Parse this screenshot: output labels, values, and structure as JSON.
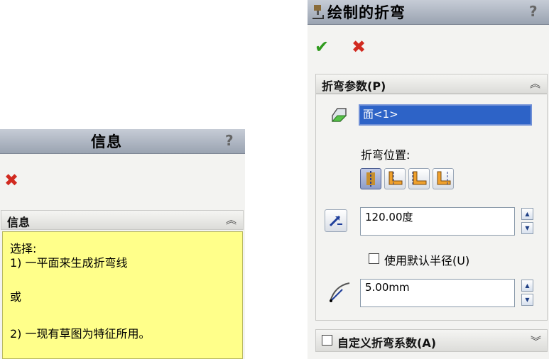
{
  "info_panel": {
    "title": "信息",
    "help": "?",
    "group_title": "信息",
    "lines": {
      "line1": "选择:",
      "line2": "1) 一平面来生成折弯线",
      "line3": "或",
      "line4": "2) 一现有草图为特征所用。"
    }
  },
  "bend_panel": {
    "title": "绘制的折弯",
    "help": "?",
    "params_group_title": "折弯参数(P)",
    "face_value": "面<1>",
    "bend_position_label": "折弯位置:",
    "angle_value": "120.00度",
    "use_default_radius_label": "使用默认半径(U)",
    "radius_value": "5.00mm",
    "custom_bend_title": "自定义折弯系数(A)"
  },
  "colors": {
    "title_gradient_top": "#c6ccd6",
    "info_yellow": "#ffff8a",
    "selection_blue": "#2d63c7",
    "ok_green": "#2f9a1d",
    "cancel_red": "#d12a20"
  },
  "icons": {
    "ok": "check-icon",
    "cancel": "close-icon",
    "expand": "chevron-up-icon",
    "collapse": "chevron-down-icon"
  }
}
